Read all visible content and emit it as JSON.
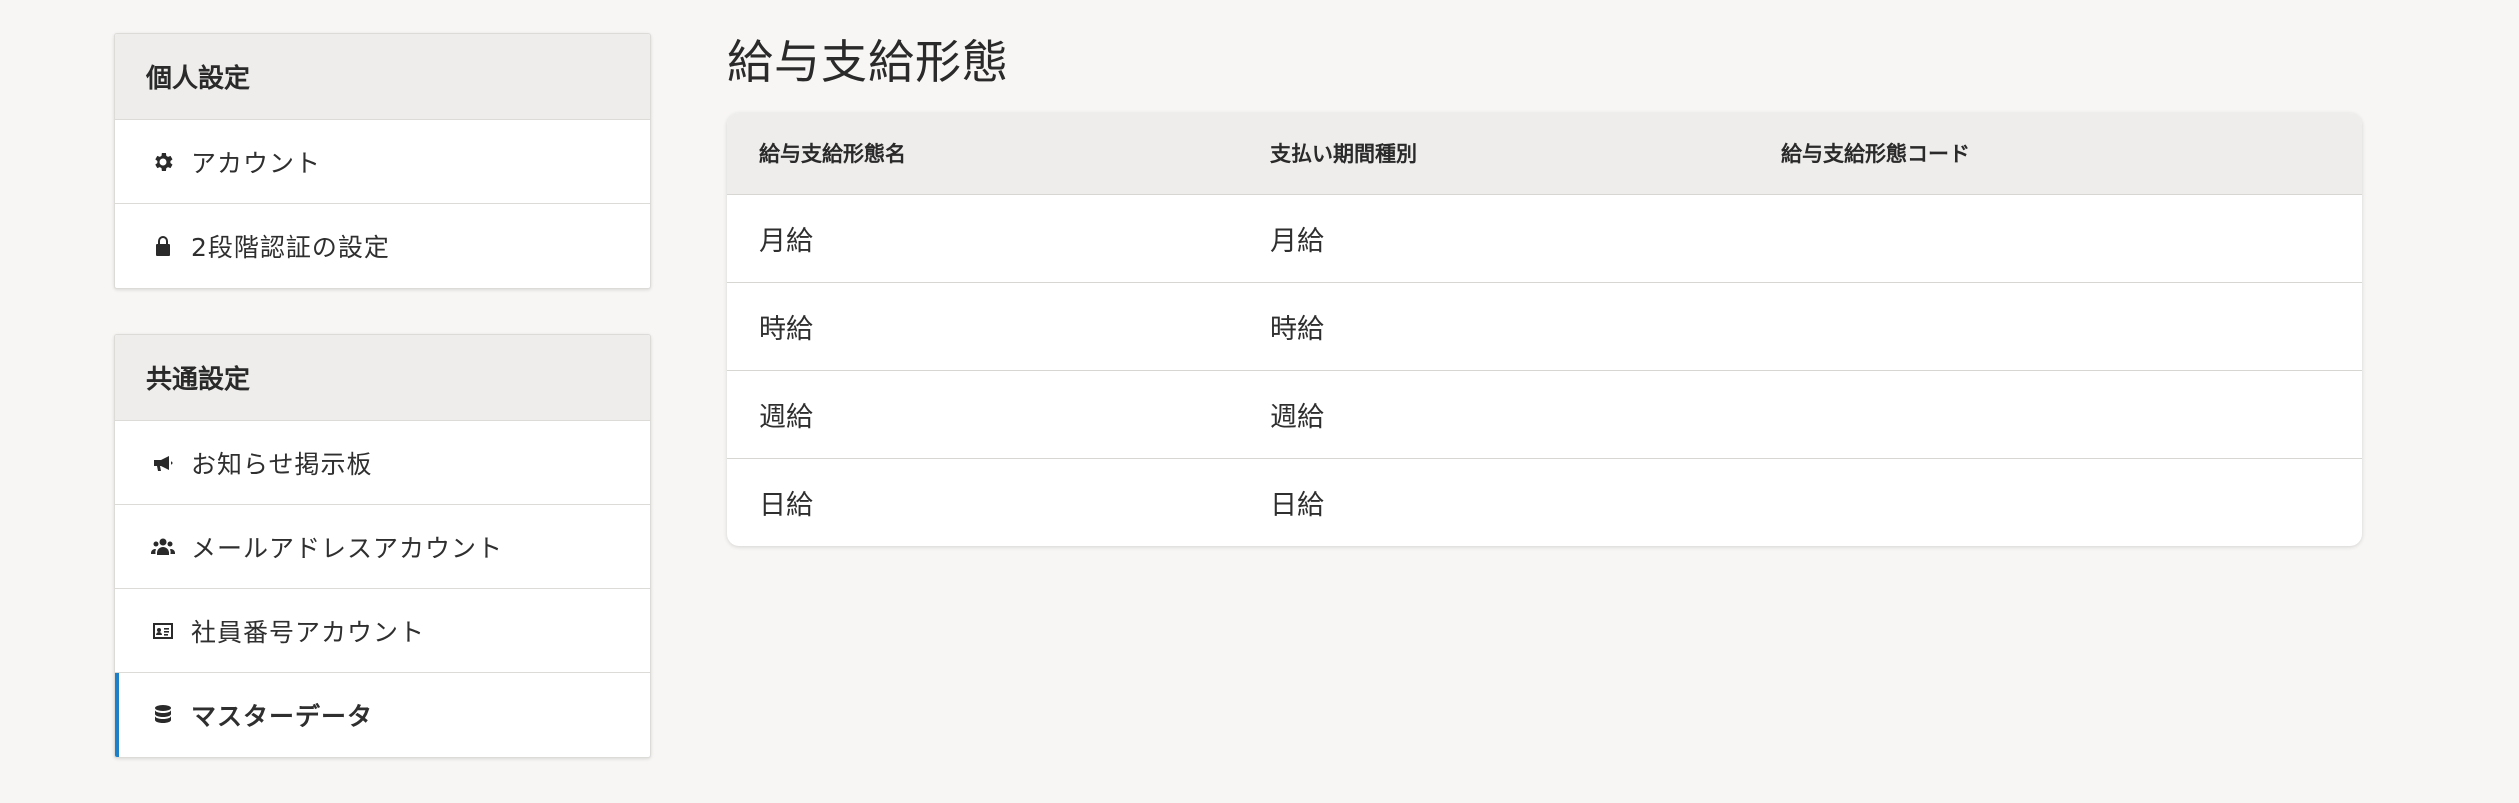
{
  "sidebar": {
    "personal": {
      "header": "個人設定",
      "items": [
        {
          "label": "アカウント",
          "icon": "gear-icon"
        },
        {
          "label": "2段階認証の設定",
          "icon": "lock-icon"
        }
      ]
    },
    "common": {
      "header": "共通設定",
      "items": [
        {
          "label": "お知らせ掲示板",
          "icon": "megaphone-icon"
        },
        {
          "label": "メールアドレスアカウント",
          "icon": "users-icon"
        },
        {
          "label": "社員番号アカウント",
          "icon": "id-card-icon"
        },
        {
          "label": "マスターデータ",
          "icon": "database-icon",
          "active": true
        }
      ]
    }
  },
  "main": {
    "title": "給与支給形態",
    "table": {
      "columns": [
        "給与支給形態名",
        "支払い期間種別",
        "給与支給形態コード"
      ],
      "rows": [
        [
          "月給",
          "月給",
          ""
        ],
        [
          "時給",
          "時給",
          ""
        ],
        [
          "週給",
          "週給",
          ""
        ],
        [
          "日給",
          "日給",
          ""
        ]
      ]
    }
  },
  "colors": {
    "active_accent": "#1e7fc9",
    "header_bg": "#eeedeb",
    "page_bg": "#f7f6f4"
  }
}
